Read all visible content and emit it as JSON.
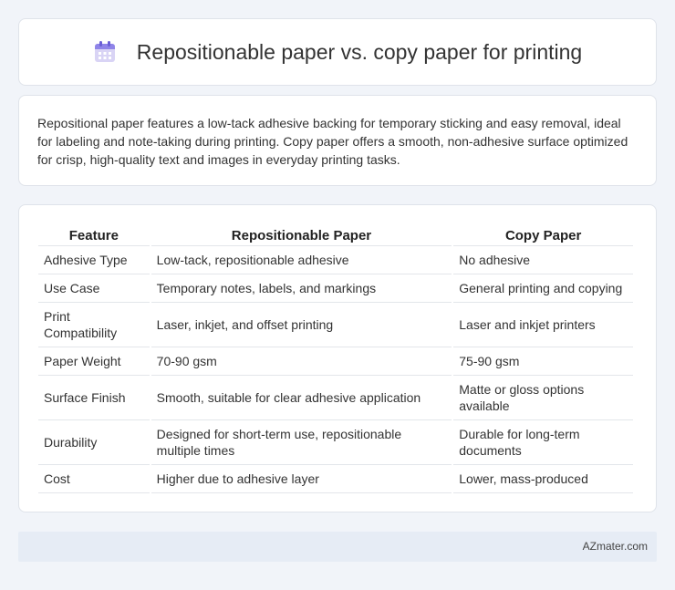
{
  "header": {
    "title": "Repositionable paper vs. copy paper for printing",
    "icon": "calendar-icon"
  },
  "description": "Repositional paper features a low-tack adhesive backing for temporary sticking and easy removal, ideal for labeling and note-taking during printing. Copy paper offers a smooth, non-adhesive surface optimized for crisp, high-quality text and images in everyday printing tasks.",
  "table": {
    "headers": [
      "Feature",
      "Repositionable Paper",
      "Copy Paper"
    ],
    "rows": [
      [
        "Adhesive Type",
        "Low-tack, repositionable adhesive",
        "No adhesive"
      ],
      [
        "Use Case",
        "Temporary notes, labels, and markings",
        "General printing and copying"
      ],
      [
        "Print Compatibility",
        "Laser, inkjet, and offset printing",
        "Laser and inkjet printers"
      ],
      [
        "Paper Weight",
        "70-90 gsm",
        "75-90 gsm"
      ],
      [
        "Surface Finish",
        "Smooth, suitable for clear adhesive application",
        "Matte or gloss options available"
      ],
      [
        "Durability",
        "Designed for short-term use, repositionable multiple times",
        "Durable for long-term documents"
      ],
      [
        "Cost",
        "Higher due to adhesive layer",
        "Lower, mass-produced"
      ]
    ]
  },
  "footer": {
    "brand": "AZmater.com"
  }
}
